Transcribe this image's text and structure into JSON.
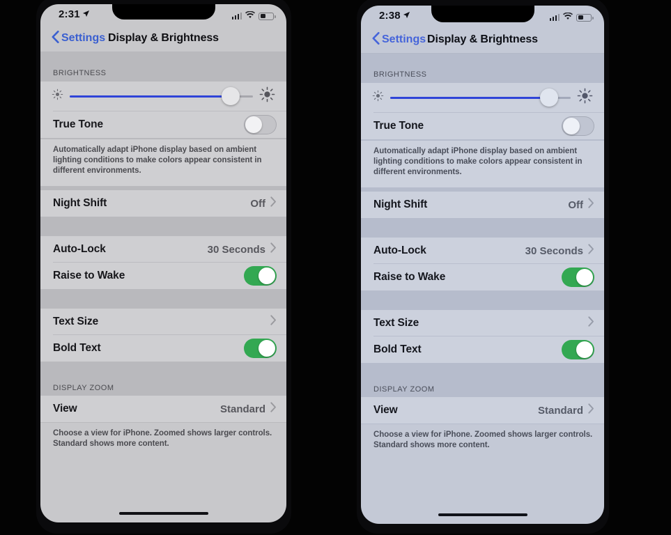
{
  "scene": {
    "background_color": "#030303",
    "description": "Two iPhone X handsets side by side showing the iOS Display & Brightness settings screen"
  },
  "phones": [
    {
      "id": "left",
      "tint": "warm",
      "status_bar": {
        "time": "2:31",
        "location_icon": "location-arrow-icon",
        "signal_icon": "cellular-signal-icon",
        "signal_bars": 3,
        "wifi_icon": "wifi-icon",
        "battery_icon": "battery-icon",
        "battery_level_percent": 42
      },
      "nav": {
        "back_icon": "chevron-left-icon",
        "back_label": "Settings",
        "title": "Display & Brightness"
      },
      "sections": [
        {
          "header": "BRIGHTNESS",
          "rows": [
            {
              "type": "slider",
              "name": "brightness-slider",
              "low_icon": "sun-low-icon",
              "high_icon": "sun-high-icon",
              "value_percent": 88
            },
            {
              "type": "toggle",
              "name": "true-tone",
              "title": "True Tone",
              "state": "off"
            }
          ],
          "footer": "Automatically adapt iPhone display based on ambient lighting conditions to make colors appear consistent in different environments."
        },
        {
          "header": "",
          "rows": [
            {
              "type": "value",
              "name": "night-shift",
              "title": "Night Shift",
              "value": "Off",
              "accessory": "chevron-right-icon"
            }
          ],
          "footer": ""
        },
        {
          "header": "",
          "rows": [
            {
              "type": "value",
              "name": "auto-lock",
              "title": "Auto-Lock",
              "value": "30 Seconds",
              "accessory": "chevron-right-icon"
            },
            {
              "type": "toggle",
              "name": "raise-to-wake",
              "title": "Raise to Wake",
              "state": "on"
            }
          ],
          "footer": ""
        },
        {
          "header": "",
          "rows": [
            {
              "type": "value",
              "name": "text-size",
              "title": "Text Size",
              "value": "",
              "accessory": "chevron-right-icon"
            },
            {
              "type": "toggle",
              "name": "bold-text",
              "title": "Bold Text",
              "state": "on"
            }
          ],
          "footer": ""
        },
        {
          "header": "DISPLAY ZOOM",
          "rows": [
            {
              "type": "value",
              "name": "view",
              "title": "View",
              "value": "Standard",
              "accessory": "chevron-right-icon"
            }
          ],
          "footer": "Choose a view for iPhone. Zoomed shows larger controls. Standard shows more content."
        }
      ]
    },
    {
      "id": "right",
      "tint": "cool",
      "status_bar": {
        "time": "2:38",
        "location_icon": "location-arrow-icon",
        "signal_icon": "cellular-signal-icon",
        "signal_bars": 3,
        "wifi_icon": "wifi-icon",
        "battery_icon": "battery-icon",
        "battery_level_percent": 42
      },
      "nav": {
        "back_icon": "chevron-left-icon",
        "back_label": "Settings",
        "title": "Display & Brightness"
      },
      "sections": [
        {
          "header": "BRIGHTNESS",
          "rows": [
            {
              "type": "slider",
              "name": "brightness-slider",
              "low_icon": "sun-low-icon",
              "high_icon": "sun-high-icon",
              "value_percent": 88
            },
            {
              "type": "toggle",
              "name": "true-tone",
              "title": "True Tone",
              "state": "off"
            }
          ],
          "footer": "Automatically adapt iPhone display based on ambient lighting conditions to make colors appear consistent in different environments."
        },
        {
          "header": "",
          "rows": [
            {
              "type": "value",
              "name": "night-shift",
              "title": "Night Shift",
              "value": "Off",
              "accessory": "chevron-right-icon"
            }
          ],
          "footer": ""
        },
        {
          "header": "",
          "rows": [
            {
              "type": "value",
              "name": "auto-lock",
              "title": "Auto-Lock",
              "value": "30 Seconds",
              "accessory": "chevron-right-icon"
            },
            {
              "type": "toggle",
              "name": "raise-to-wake",
              "title": "Raise to Wake",
              "state": "on"
            }
          ],
          "footer": ""
        },
        {
          "header": "",
          "rows": [
            {
              "type": "value",
              "name": "text-size",
              "title": "Text Size",
              "value": "",
              "accessory": "chevron-right-icon"
            },
            {
              "type": "toggle",
              "name": "bold-text",
              "title": "Bold Text",
              "state": "on"
            }
          ],
          "footer": ""
        },
        {
          "header": "DISPLAY ZOOM",
          "rows": [
            {
              "type": "value",
              "name": "view",
              "title": "View",
              "value": "Standard",
              "accessory": "chevron-right-icon"
            }
          ],
          "footer": "Choose a view for iPhone. Zoomed shows larger controls. Standard shows more content."
        }
      ]
    }
  ],
  "colors": {
    "toggle_on": "#33a852",
    "slider_fill": "#2f44d8",
    "link_blue": "#3a5fd0",
    "screen_warm": "#c8c8cb",
    "screen_cool": "#c4c9d6"
  }
}
